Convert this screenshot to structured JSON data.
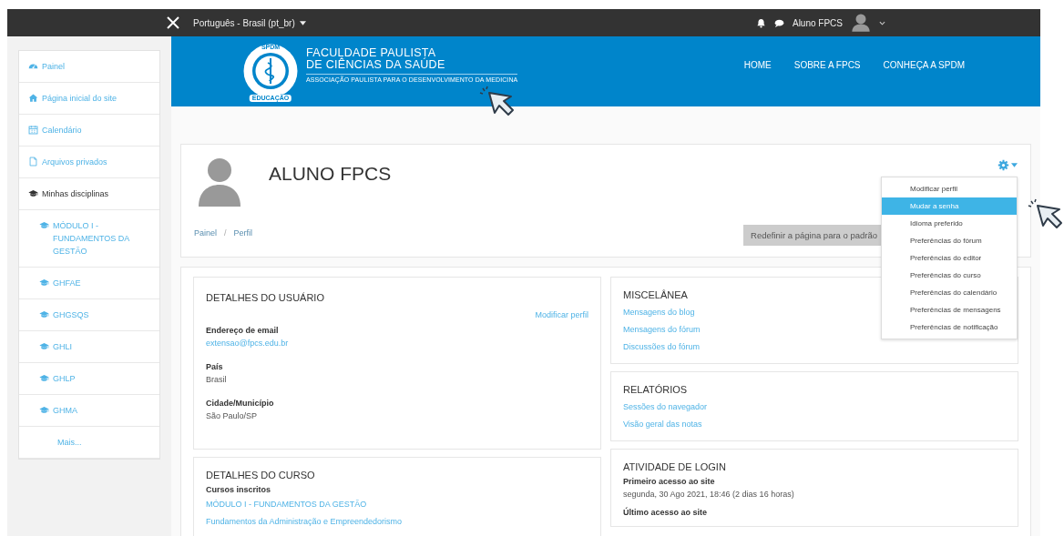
{
  "top_bar": {
    "language": "Português - Brasil (pt_br)",
    "user_name": "Aluno FPCS"
  },
  "header": {
    "logo_top": "SPDM",
    "logo_bottom": "EDUCAÇÃO",
    "title_lines": [
      "FACULDADE PAULISTA",
      "DE CIÊNCIAS DA SAÚDE"
    ],
    "subtitle": "ASSOCIAÇÃO PAULISTA PARA O DESENVOLVIMENTO DA MEDICINA",
    "nav": [
      "HOME",
      "SOBRE A FPCS",
      "CONHEÇA A SPDM"
    ]
  },
  "sidebar": {
    "items": [
      {
        "kind": "dashboard",
        "label": "Painel"
      },
      {
        "kind": "home",
        "label": "Página inicial do site"
      },
      {
        "kind": "calendar",
        "label": "Calendário"
      },
      {
        "kind": "file",
        "label": "Arquivos privados"
      },
      {
        "kind": "heading",
        "label": "Minhas disciplinas",
        "children": [
          {
            "kind": "course",
            "label": "MÓDULO I - FUNDAMENTOS DA GESTÃO"
          },
          {
            "kind": "course",
            "label": "GHFAE"
          },
          {
            "kind": "course",
            "label": "GHGSQS"
          },
          {
            "kind": "course",
            "label": "GHLI"
          },
          {
            "kind": "course",
            "label": "GHLP"
          },
          {
            "kind": "course",
            "label": "GHMA"
          },
          {
            "kind": "more",
            "label": "Mais..."
          }
        ]
      }
    ]
  },
  "profile": {
    "name": "ALUNO FPCS",
    "breadcrumb": [
      "Painel",
      "Perfil"
    ],
    "breadcrumb_separator": "/",
    "reset_button": "Redefinir a página para o padrão",
    "menu": [
      {
        "label": "Modificar perfil",
        "selected": false
      },
      {
        "label": "Mudar a senha",
        "selected": true
      },
      {
        "label": "Idioma preferido",
        "selected": false
      },
      {
        "label": "Preferências do fórum",
        "selected": false
      },
      {
        "label": "Preferências do editor",
        "selected": false
      },
      {
        "label": "Preferências do curso",
        "selected": false
      },
      {
        "label": "Preferências do calendário",
        "selected": false
      },
      {
        "label": "Preferências de mensagens",
        "selected": false
      },
      {
        "label": "Preferências de notificação",
        "selected": false
      }
    ]
  },
  "columns": [
    [
      {
        "title": "DETALHES DO USUÁRIO",
        "edit_link": "Modificar perfil",
        "fields": [
          {
            "label": "Endereço de email",
            "value": "extensao@fpcs.edu.br",
            "kind": "link"
          },
          {
            "label": "País",
            "value": "Brasil",
            "kind": "text"
          },
          {
            "label": "Cidade/Município",
            "value": "São Paulo/SP",
            "kind": "text"
          }
        ]
      },
      {
        "title": "DETALHES DO CURSO",
        "fields": [
          {
            "label": "Cursos inscritos",
            "links": [
              "MÓDULO I - FUNDAMENTOS DA GESTÃO",
              "Fundamentos da Administração e Empreendedorismo"
            ],
            "kind": "links"
          }
        ]
      }
    ],
    [
      {
        "title": "MISCELÂNEA",
        "links": [
          "Mensagens do blog",
          "Mensagens do fórum",
          "Discussões do fórum"
        ]
      },
      {
        "title": "RELATÓRIOS",
        "links": [
          "Sessões do navegador",
          "Visão geral das notas"
        ]
      },
      {
        "title": "ATIVIDADE DE LOGIN",
        "fields": [
          {
            "label": "Primeiro acesso ao site",
            "value": "segunda, 30 Ago 2021, 18:46  (2 dias 16 horas)",
            "kind": "text"
          },
          {
            "label": "Último acesso ao site",
            "kind": "text"
          }
        ]
      }
    ]
  ]
}
